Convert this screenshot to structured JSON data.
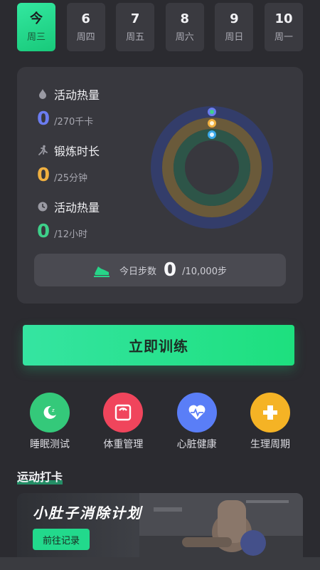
{
  "days": [
    {
      "num": "今",
      "week": "周三",
      "active": true
    },
    {
      "num": "6",
      "week": "周四"
    },
    {
      "num": "7",
      "week": "周五"
    },
    {
      "num": "8",
      "week": "周六"
    },
    {
      "num": "9",
      "week": "周日"
    },
    {
      "num": "10",
      "week": "周一"
    }
  ],
  "metrics": [
    {
      "label": "活动热量",
      "value": "0",
      "unit": "/270千卡",
      "color": "#6b7cf0",
      "icon": "flame-icon"
    },
    {
      "label": "锻炼时长",
      "value": "0",
      "unit": "/25分钟",
      "color": "#f0b040",
      "icon": "running-icon"
    },
    {
      "label": "活动热量",
      "value": "0",
      "unit": "/12小时",
      "color": "#3ed08a",
      "icon": "clock-icon"
    }
  ],
  "rings": {
    "progress": [
      0,
      0,
      0
    ]
  },
  "steps": {
    "label": "今日步数",
    "value": "0",
    "goal": "/10,000步"
  },
  "train_button": "立即训练",
  "tools": [
    {
      "name": "睡眠测试",
      "color": "#34c97a",
      "icon": "sleep-icon"
    },
    {
      "name": "体重管理",
      "color": "#f0455c",
      "icon": "scale-icon"
    },
    {
      "name": "心脏健康",
      "color": "#5a7ef7",
      "icon": "heart-icon"
    },
    {
      "name": "生理周期",
      "color": "#f5b325",
      "icon": "cycle-icon"
    }
  ],
  "section_title": "运动打卡",
  "banner": {
    "title": "小肚子消除计划",
    "button": "前往记录"
  }
}
